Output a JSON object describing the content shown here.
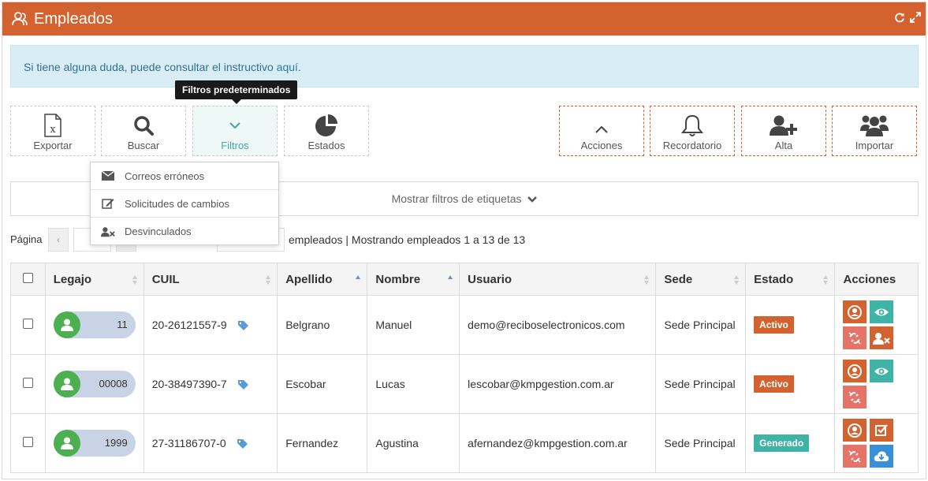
{
  "header": {
    "title": "Empleados",
    "color": "#d3622f"
  },
  "alert": {
    "text": "Si tiene alguna duda, puede consultar el instructivo ",
    "link": "aquí",
    "suffix": "."
  },
  "tooltip": {
    "text": "Filtros predeterminados"
  },
  "toolbar": {
    "left": [
      {
        "label": "Exportar",
        "icon": "excel-file-icon"
      },
      {
        "label": "Buscar",
        "icon": "search-icon"
      },
      {
        "label": "Filtros",
        "icon": "chevron-down-icon",
        "active": true
      },
      {
        "label": "Estados",
        "icon": "pie-chart-icon"
      }
    ],
    "right": [
      {
        "label": "Acciones",
        "icon": "chevron-up-icon"
      },
      {
        "label": "Recordatorio",
        "icon": "bell-icon"
      },
      {
        "label": "Alta",
        "icon": "user-plus-icon"
      },
      {
        "label": "Importar",
        "icon": "users-icon"
      }
    ]
  },
  "dropdown": {
    "items": [
      {
        "label": "Correos erróneos",
        "icon": "envelope-icon"
      },
      {
        "label": "Solicitudes de cambios",
        "icon": "edit-icon"
      },
      {
        "label": "Desvinculados",
        "icon": "user-remove-icon"
      }
    ]
  },
  "tag_filters": {
    "label": "Mostrar filtros de etiquetas"
  },
  "pager": {
    "label": "Página",
    "info": "empleados | Mostrando empleados 1 a 13 de 13"
  },
  "table": {
    "columns": [
      "Legajo",
      "CUIL",
      "Apellido",
      "Nombre",
      "Usuario",
      "Sede",
      "Estado",
      "Acciones"
    ],
    "rows": [
      {
        "legajo": "11",
        "cuil": "20-26121557-9",
        "apellido": "Belgrano",
        "nombre": "Manuel",
        "usuario": "demo@reciboselectronicos.com",
        "sede": "Sede Principal",
        "estado": "Activo",
        "estado_color": "#d3622f"
      },
      {
        "legajo": "00008",
        "cuil": "20-38497390-7",
        "apellido": "Escobar",
        "nombre": "Lucas",
        "usuario": "lescobar@kmpgestion.com.ar",
        "sede": "Sede Principal",
        "estado": "Activo",
        "estado_color": "#d3622f"
      },
      {
        "legajo": "1999",
        "cuil": "27-31186707-0",
        "apellido": "Fernandez",
        "nombre": "Agustina",
        "usuario": "afernandez@kmpgestion.com.ar",
        "sede": "Sede Principal",
        "estado": "Generado",
        "estado_color": "#3fb3a6"
      }
    ]
  },
  "colors": {
    "accent": "#d3622f",
    "teal": "#3fb3a6",
    "salmon": "#e57368",
    "info_bg": "#d9edf7",
    "avatar_green": "#4caf50",
    "tag_blue": "#5b9bd5"
  }
}
